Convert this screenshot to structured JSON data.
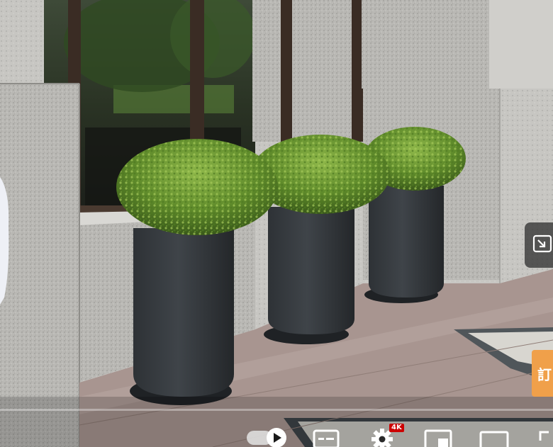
{
  "player": {
    "overlay": {
      "miniplayer_icon": "miniplayer-icon",
      "subscribe_text": "訂"
    },
    "progress": {
      "played_fraction": 0.0
    },
    "controls": {
      "quality_badge": "4K",
      "icons": [
        "play-icon",
        "subtitles-icon",
        "settings-gear-icon",
        "miniplayer-icon",
        "theater-mode-icon",
        "fullscreen-icon"
      ]
    }
  }
}
